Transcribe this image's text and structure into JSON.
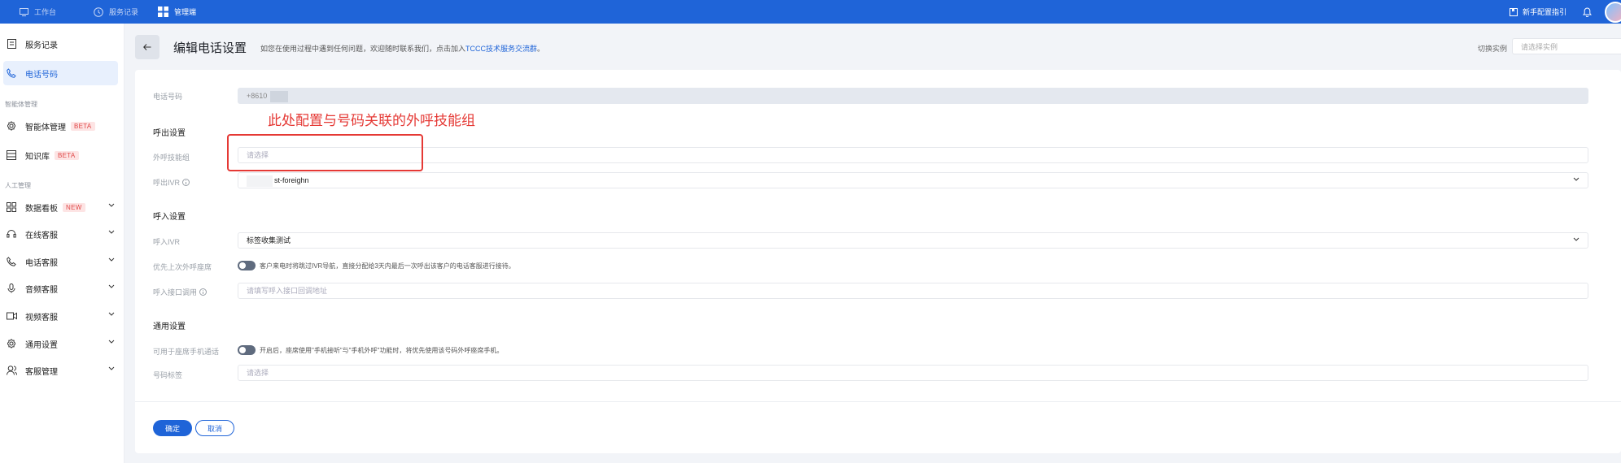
{
  "topbar": {
    "items": [
      {
        "label": "工作台",
        "icon": "monitor-icon"
      },
      {
        "label": "服务记录",
        "icon": "clock-icon"
      },
      {
        "label": "管理端",
        "icon": "grid-icon"
      }
    ],
    "guide_label": "新手配置指引"
  },
  "sidebar": {
    "service_record": "服务记录",
    "phone_number": "电话号码",
    "section_agent": "智能体管理",
    "agent_mgmt": "智能体管理",
    "knowledge_base": "知识库",
    "badge_beta": "BETA",
    "section_human": "人工管理",
    "dashboard": "数据看板",
    "badge_new": "NEW",
    "online_service": "在线客服",
    "phone_service": "电话客服",
    "audio_service": "音频客服",
    "video_service": "视频客服",
    "general_settings": "通用设置",
    "agent_management": "客服管理"
  },
  "header": {
    "title": "编辑电话设置",
    "desc_prefix": "如您在使用过程中遇到任何问题，欢迎随时联系我们，点击加入",
    "desc_link": "TCCC技术服务交流群",
    "desc_suffix": "。",
    "switch_label": "切换实例",
    "switch_placeholder": "请选择实例"
  },
  "form": {
    "phone_label": "电话号码",
    "phone_value": "+8610",
    "outbound_section": "呼出设置",
    "outbound_skill_label": "外呼技能组",
    "outbound_skill_placeholder": "请选择",
    "outbound_ivr_label": "呼出IVR",
    "outbound_ivr_value": "st-foreighn",
    "inbound_section": "呼入设置",
    "inbound_ivr_label": "呼入IVR",
    "inbound_ivr_value": "标签收集测试",
    "priority_label": "优先上次外呼座席",
    "priority_desc": "客户来电时将跳过IVR导航，直接分配给3天内最后一次呼出该客户的电话客服进行接待。",
    "callback_label": "呼入接口调用",
    "callback_placeholder": "请填写呼入接口回调地址",
    "general_section": "通用设置",
    "mobile_label": "可用于座席手机通话",
    "mobile_desc": "开启后，座席使用\"手机接听\"与\"手机外呼\"功能时，将优先使用该号码外呼座席手机。",
    "tag_label": "号码标签",
    "tag_placeholder": "请选择",
    "confirm": "确定",
    "cancel": "取消"
  },
  "annotation": {
    "text": "此处配置与号码关联的外呼技能组",
    "color": "#e53935"
  },
  "colors": {
    "primary": "#1f64d8",
    "topbar": "#1f64d8",
    "page_bg": "#f2f4f8"
  }
}
